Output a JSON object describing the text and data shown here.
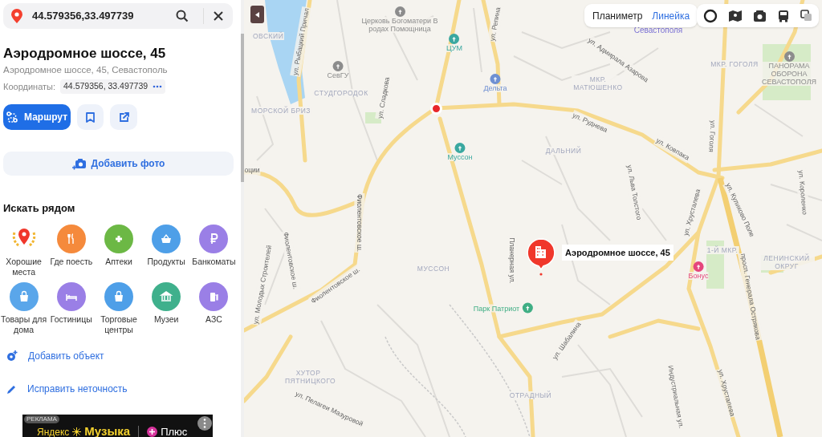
{
  "search": {
    "value": "44.579356,33.497739"
  },
  "place": {
    "title": "Аэродромное шоссе, 45",
    "address": "Аэродромное шоссе, 45, Севастополь",
    "coords_label": "Координаты:",
    "coords": "44.579356, 33.497739"
  },
  "route_button": "Маршрут",
  "add_photo": "Добавить фото",
  "nearby": {
    "title": "Искать рядом",
    "items": [
      {
        "label": "Хорошие места",
        "kind": "laurel"
      },
      {
        "label": "Где поесть",
        "kind": "food",
        "color": "#f58a3c"
      },
      {
        "label": "Аптеки",
        "kind": "pharmacy",
        "color": "#6cb845"
      },
      {
        "label": "Продукты",
        "kind": "grocery",
        "color": "#4e9fe8"
      },
      {
        "label": "Банкоматы",
        "kind": "atm",
        "color": "#9a7fe6"
      },
      {
        "label": "Товары для дома",
        "kind": "bag",
        "color": "#5aa6ea"
      },
      {
        "label": "Гостиницы",
        "kind": "hotel",
        "color": "#9a7fe6"
      },
      {
        "label": "Торговые центры",
        "kind": "bag",
        "color": "#4e9fe8"
      },
      {
        "label": "Музеи",
        "kind": "museum",
        "color": "#3fb08c"
      },
      {
        "label": "АЗС",
        "kind": "fuel",
        "color": "#9a7fe6"
      }
    ]
  },
  "links": [
    {
      "kind": "add",
      "label": "Добавить объект"
    },
    {
      "kind": "edit",
      "label": "Исправить неточность"
    }
  ],
  "ad": {
    "badge": "РЕКЛАМА",
    "brand": "Яндекс",
    "product": "Музыка",
    "plus": "Плюс"
  },
  "map_tools": [
    {
      "label": "Планиметр",
      "selected": false
    },
    {
      "label": "Линейка",
      "selected": true
    }
  ],
  "marker": {
    "label": "Аэродромное шоссе, 45"
  },
  "map_labels": [
    {
      "text": "Церковь Богоматери В родах Помощница",
      "kind": "poi",
      "color": "#8c8c8c"
    },
    {
      "text": "ЦУМ",
      "kind": "poi",
      "color": "#3aa8a0"
    },
    {
      "text": "СевГУ",
      "kind": "poi",
      "color": "#8c8c8c"
    },
    {
      "text": "СТУДГОРОДОК",
      "kind": "district"
    },
    {
      "text": "Дельта",
      "kind": "poi",
      "color": "#6f90d2"
    },
    {
      "text": "ОВСКИЙ",
      "kind": "district"
    },
    {
      "text": "МОРСКОЙ БРИЗ",
      "kind": "district"
    },
    {
      "text": "оции",
      "kind": "street"
    },
    {
      "text": "Муссон",
      "kind": "poi",
      "color": "#3aa8a0"
    },
    {
      "text": "МУССОН",
      "kind": "district"
    },
    {
      "text": "Парк Патриот",
      "kind": "poi_inline",
      "color": "#3fae84"
    },
    {
      "text": "ХУТОР ПЯТНИЦКОГО",
      "kind": "district"
    },
    {
      "text": "ОТРАДНЫЙ",
      "kind": "district"
    },
    {
      "text": "ДАЛЬНИЙ",
      "kind": "district"
    },
    {
      "text": "МКР. МАТЮШЕНКО",
      "kind": "district"
    },
    {
      "text": "МКР. ГОГОЛЯ",
      "kind": "district"
    },
    {
      "text": "ПАНОРАМА ОБОРОНА СЕВАСТОПОЛЯ",
      "kind": "poi",
      "color": "#8c8c8c"
    },
    {
      "text": "1-Й МКР.",
      "kind": "district"
    },
    {
      "text": "ЛЕНИНСКИЙ ОКРУГ",
      "kind": "district"
    },
    {
      "text": "Бонус",
      "kind": "poi",
      "color": "#e5467c"
    },
    {
      "text": "ул. Рыбацкий Причал",
      "kind": "street"
    },
    {
      "text": "ул. Сладкова",
      "kind": "street"
    },
    {
      "text": "ул. Репина",
      "kind": "street"
    },
    {
      "text": "Фиолентовское ш.",
      "kind": "street"
    },
    {
      "text": "Фиолентовское ш.",
      "kind": "street"
    },
    {
      "text": "Фиолентовское ш.",
      "kind": "street"
    },
    {
      "text": "ул. Молодых Строителей",
      "kind": "street"
    },
    {
      "text": "Планерная ул.",
      "kind": "street"
    },
    {
      "text": "ул. Шабалина",
      "kind": "street"
    },
    {
      "text": "ул. Пелагеи Мазуровой",
      "kind": "street"
    },
    {
      "text": "ул. Адмирала Азарова",
      "kind": "street"
    },
    {
      "text": "ул. Руднева",
      "kind": "street"
    },
    {
      "text": "ул. Ковпака",
      "kind": "street"
    },
    {
      "text": "ул. Льва Толстого",
      "kind": "street"
    },
    {
      "text": "ул. Хрусталева",
      "kind": "street"
    },
    {
      "text": "ул. Куликово Поле",
      "kind": "street"
    },
    {
      "text": "ул. Короленко",
      "kind": "street"
    },
    {
      "text": "просп. Генерала Острякова",
      "kind": "street"
    },
    {
      "text": "Индустриальная ул.",
      "kind": "street"
    },
    {
      "text": "ул. Хрусталева",
      "kind": "street"
    },
    {
      "text": "ул. Гоголя",
      "kind": "street"
    },
    {
      "text": "Севастополя",
      "kind": "place"
    }
  ]
}
